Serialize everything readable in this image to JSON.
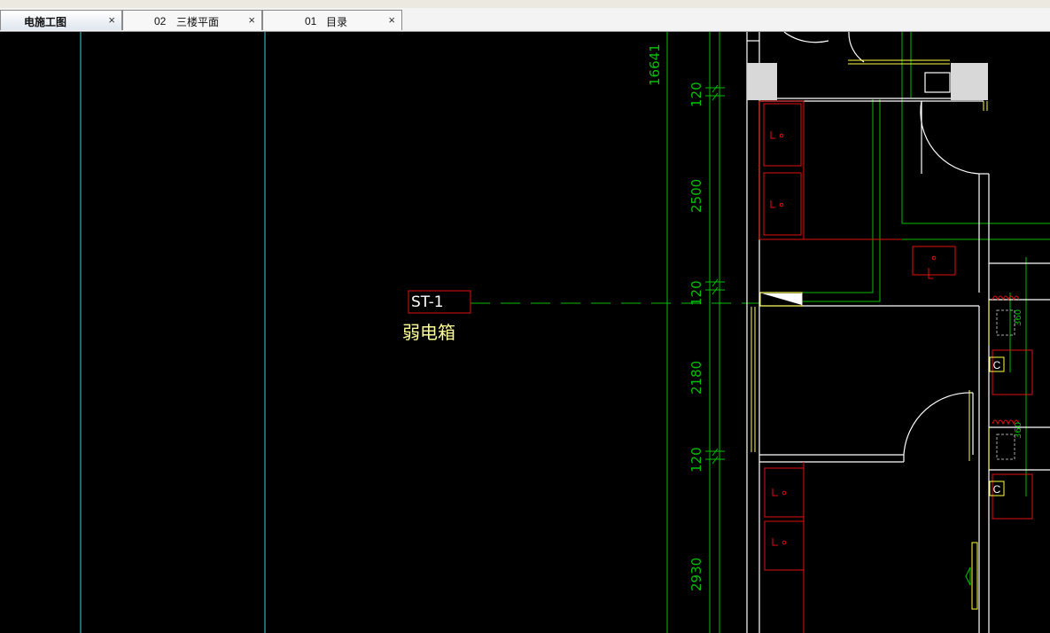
{
  "tabs": [
    {
      "num": "",
      "title": "电施工图",
      "close": "×"
    },
    {
      "num": "02",
      "title": "三楼平面",
      "close": "×"
    },
    {
      "num": "01",
      "title": "目录",
      "close": "×"
    }
  ],
  "drawing": {
    "tag_label": "ST-1",
    "tag_caption": "弱电箱",
    "total_dimension": "16641",
    "dimensions": [
      "120",
      "2500",
      "120",
      "2180",
      "120",
      "2930"
    ],
    "small_dims": [
      "360",
      "360"
    ],
    "switch_labels": [
      "C",
      "C"
    ]
  },
  "colors": {
    "background": "#000000",
    "green": "#00c000",
    "red": "#e01010",
    "yellow": "#ffff40",
    "white": "#ffffff",
    "cyan": "#40d0d0",
    "grey": "#d8d8d8"
  }
}
